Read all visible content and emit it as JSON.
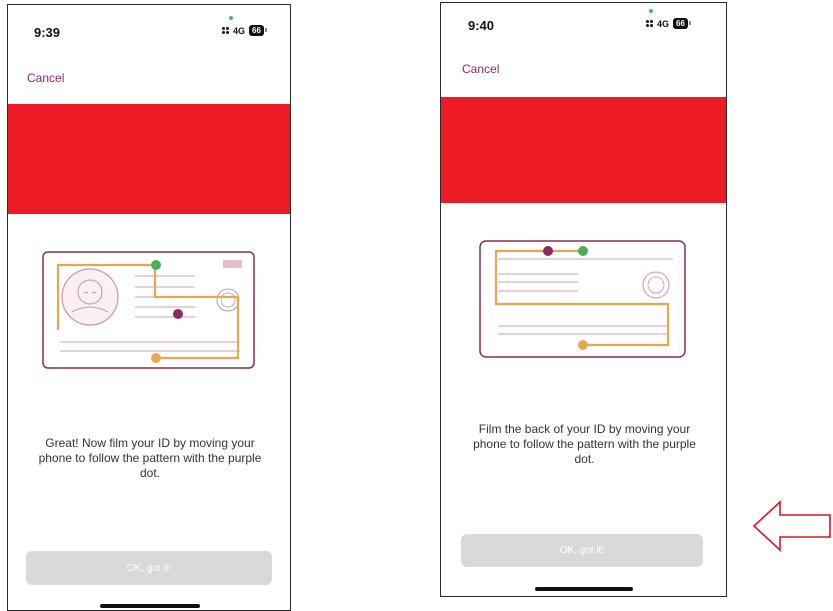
{
  "left_screen": {
    "status": {
      "time": "9:39",
      "network": "4G",
      "battery": "66"
    },
    "cancel_label": "Cancel",
    "instruction": "Great! Now film your ID by moving your phone to follow the pattern with the purple dot.",
    "button_label": "OK, got it!"
  },
  "right_screen": {
    "status": {
      "time": "9:40",
      "network": "4G",
      "battery": "66"
    },
    "cancel_label": "Cancel",
    "instruction": "Film the back of your ID by moving your phone to follow the pattern with the purple dot.",
    "button_label": "OK, got it!"
  },
  "colors": {
    "banner_red": "#ed1c24",
    "cancel_text": "#8b2a5c",
    "card_outline": "#8b2a5c",
    "path_orange": "#e8a552",
    "dot_purple": "#8b2a5c",
    "dot_green": "#4caf50",
    "button_disabled": "#d9d9d9",
    "arrow_red": "#e0141e"
  },
  "icons": {
    "annotation": "left-arrow-outline-icon"
  }
}
